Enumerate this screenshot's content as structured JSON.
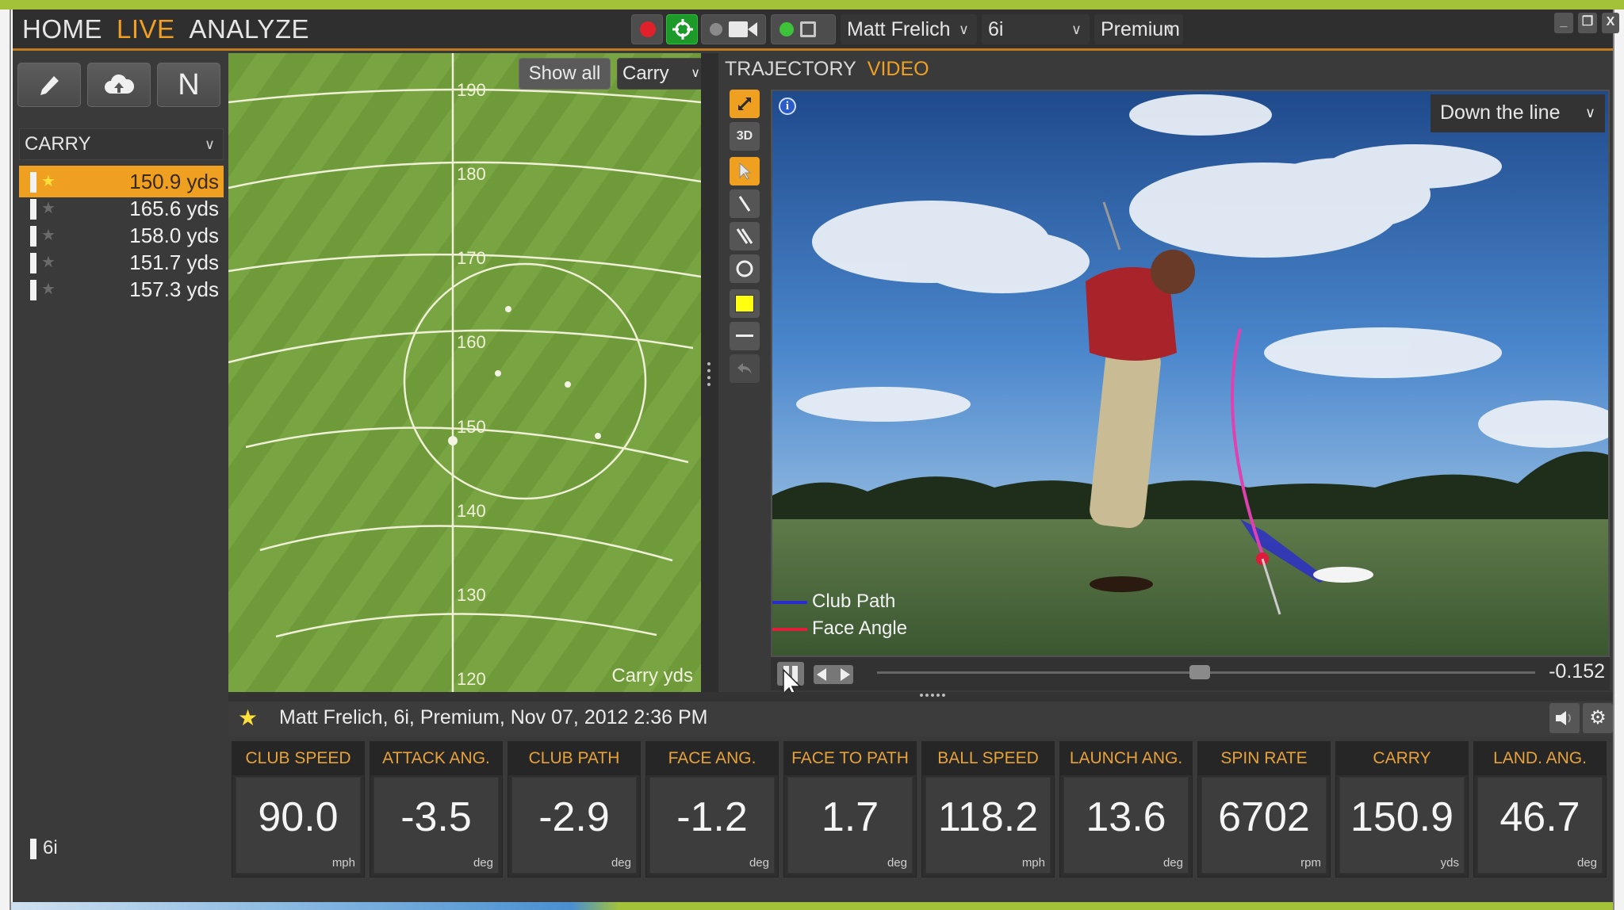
{
  "nav": {
    "home": "HOME",
    "live": "LIVE",
    "analyze": "ANALYZE"
  },
  "header": {
    "player": "Matt Frelich",
    "club": "6i",
    "ball": "Premium",
    "window": {
      "minimize": "_",
      "restore": "❐",
      "close": "X"
    }
  },
  "sidebar": {
    "tools": {
      "n_label": "N"
    },
    "metric": "CARRY",
    "shots": [
      {
        "value": "150.9 yds",
        "selected": true
      },
      {
        "value": "165.6 yds",
        "selected": false
      },
      {
        "value": "158.0 yds",
        "selected": false
      },
      {
        "value": "151.7 yds",
        "selected": false
      },
      {
        "value": "157.3 yds",
        "selected": false
      }
    ],
    "club_tag": "6i"
  },
  "dispersion": {
    "show_all": "Show all",
    "metric": "Carry",
    "axis_label": "Carry  yds",
    "range_ticks": [
      "190",
      "180",
      "170",
      "160",
      "150",
      "140",
      "130",
      "120"
    ]
  },
  "video_panel": {
    "tabs": {
      "trajectory": "TRAJECTORY",
      "video": "VIDEO"
    },
    "tools": {
      "three_d": "3D"
    },
    "view": "Down the line",
    "legend": {
      "club_path": "Club Path",
      "face_angle": "Face Angle"
    },
    "legend_colors": {
      "club_path": "#2a2ad0",
      "face_angle": "#e0203a"
    },
    "time": "-0.152",
    "scrub_progress": 0.49
  },
  "shot_info": {
    "text": "Matt Frelich, 6i, Premium, Nov 07, 2012 2:36 PM"
  },
  "metrics": [
    {
      "label": "CLUB SPEED",
      "value": "90.0",
      "unit": "mph"
    },
    {
      "label": "ATTACK ANG.",
      "value": "-3.5",
      "unit": "deg"
    },
    {
      "label": "CLUB PATH",
      "value": "-2.9",
      "unit": "deg"
    },
    {
      "label": "FACE ANG.",
      "value": "-1.2",
      "unit": "deg"
    },
    {
      "label": "FACE TO PATH",
      "value": "1.7",
      "unit": "deg"
    },
    {
      "label": "BALL SPEED",
      "value": "118.2",
      "unit": "mph"
    },
    {
      "label": "LAUNCH ANG.",
      "value": "13.6",
      "unit": "deg"
    },
    {
      "label": "SPIN RATE",
      "value": "6702",
      "unit": "rpm"
    },
    {
      "label": "CARRY",
      "value": "150.9",
      "unit": "yds"
    },
    {
      "label": "LAND. ANG.",
      "value": "46.7",
      "unit": "deg"
    }
  ],
  "colors": {
    "accent": "#f0a020",
    "brand_green": "#a3c23a",
    "label_orange": "#e7a23a"
  }
}
